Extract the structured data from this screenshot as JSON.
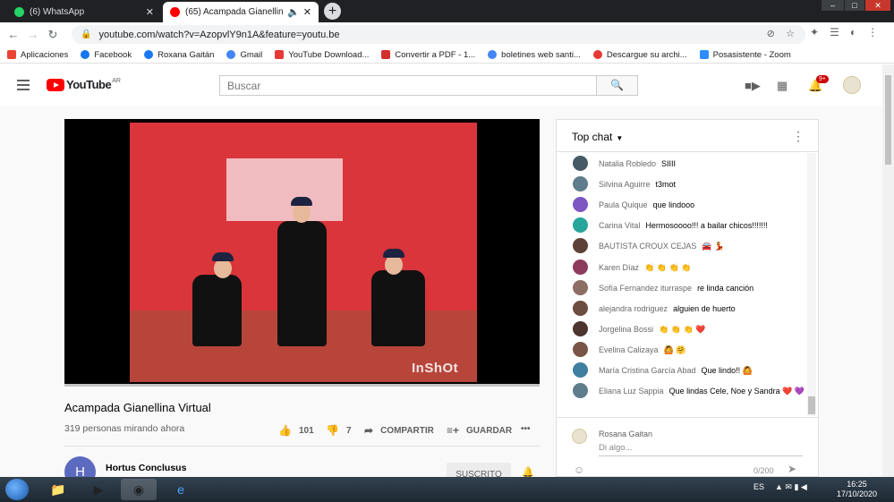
{
  "browser": {
    "tabs": [
      {
        "title": "(6) WhatsApp",
        "favicon_color": "#25d366"
      },
      {
        "title": "(65) Acampada Gianellina Virtual",
        "favicon_color": "#ff0000"
      }
    ],
    "new_tab": "+",
    "window_controls": [
      "–",
      "□",
      "✕"
    ],
    "url": "youtube.com/watch?v=AzopvlY9n1A&feature=youtu.be"
  },
  "bookmarks": [
    {
      "label": "Aplicaciones",
      "color": "#ea4335"
    },
    {
      "label": "Facebook",
      "color": "#1877f2"
    },
    {
      "label": "Roxana Gaitán",
      "color": "#1877f2"
    },
    {
      "label": "Gmail",
      "color": "#4285f4"
    },
    {
      "label": "YouTube Download...",
      "color": "#e53935"
    },
    {
      "label": "Convertir a PDF - 1...",
      "color": "#d32f2f"
    },
    {
      "label": "boletines web santi...",
      "color": "#4285f4"
    },
    {
      "label": "Descargue su archi...",
      "color": "#e53935"
    },
    {
      "label": "Posasistente - Zoom",
      "color": "#2d8cff"
    }
  ],
  "youtube": {
    "logo": "YouTube",
    "country": "AR",
    "search_placeholder": "Buscar",
    "notifications_badge": "9+"
  },
  "video": {
    "watermark": "InShOt",
    "progress": 0.0,
    "title": "Acampada Gianellina Virtual",
    "viewers": "319 personas mirando ahora",
    "likes": "101",
    "dislikes": "7",
    "share_label": "COMPARTIR",
    "save_label": "GUARDAR",
    "more": "•••",
    "channel_initial": "H",
    "channel_name": "Hortus Conclusus",
    "subscribe_label": "SUSCRITO"
  },
  "chat": {
    "header": "Top chat",
    "messages": [
      {
        "author": "Natalia Robledo",
        "text": "SIIII",
        "color": "#455a64"
      },
      {
        "author": "Silvina Aguirre",
        "text": "t3mot",
        "color": "#607d8b"
      },
      {
        "author": "Paula Quique",
        "text": "que lindooo",
        "color": "#7e57c2"
      },
      {
        "author": "Carina Vital",
        "text": "Hermosoooo!!! a bailar chicos!!!!!!!",
        "color": "#26a69a"
      },
      {
        "author": "BAUTISTA CROUX CEJAS",
        "text": "🚘 💃",
        "color": "#5d4037"
      },
      {
        "author": "Karen Díaz",
        "text": "👏 👏 👏 👏",
        "color": "#8d3b5c"
      },
      {
        "author": "Sofía Fernandez iturraspe",
        "text": "re linda canción",
        "color": "#8d6e63"
      },
      {
        "author": "alejandra rodriguez",
        "text": "alguien de huerto",
        "color": "#6d4c41"
      },
      {
        "author": "Jorgelina Bossi",
        "text": "👏 👏 👏 ❤️",
        "color": "#4e342e"
      },
      {
        "author": "Evelina Calizaya",
        "text": "🙆 🤗",
        "color": "#795548"
      },
      {
        "author": "María Cristina García Abad",
        "text": "Que lindo!! 🙆",
        "color": "#3f7f9f"
      },
      {
        "author": "Eliana Luz Sappia",
        "text": "Que lindas Cele, Noe y Sandra ❤️ 💜",
        "color": "#607d8b"
      }
    ],
    "composer_name": "Rosana Gaitan",
    "composer_placeholder": "Di algo...",
    "char_count": "0/200"
  },
  "taskbar": {
    "lang": "ES",
    "time": "16:25",
    "date": "17/10/2020"
  }
}
